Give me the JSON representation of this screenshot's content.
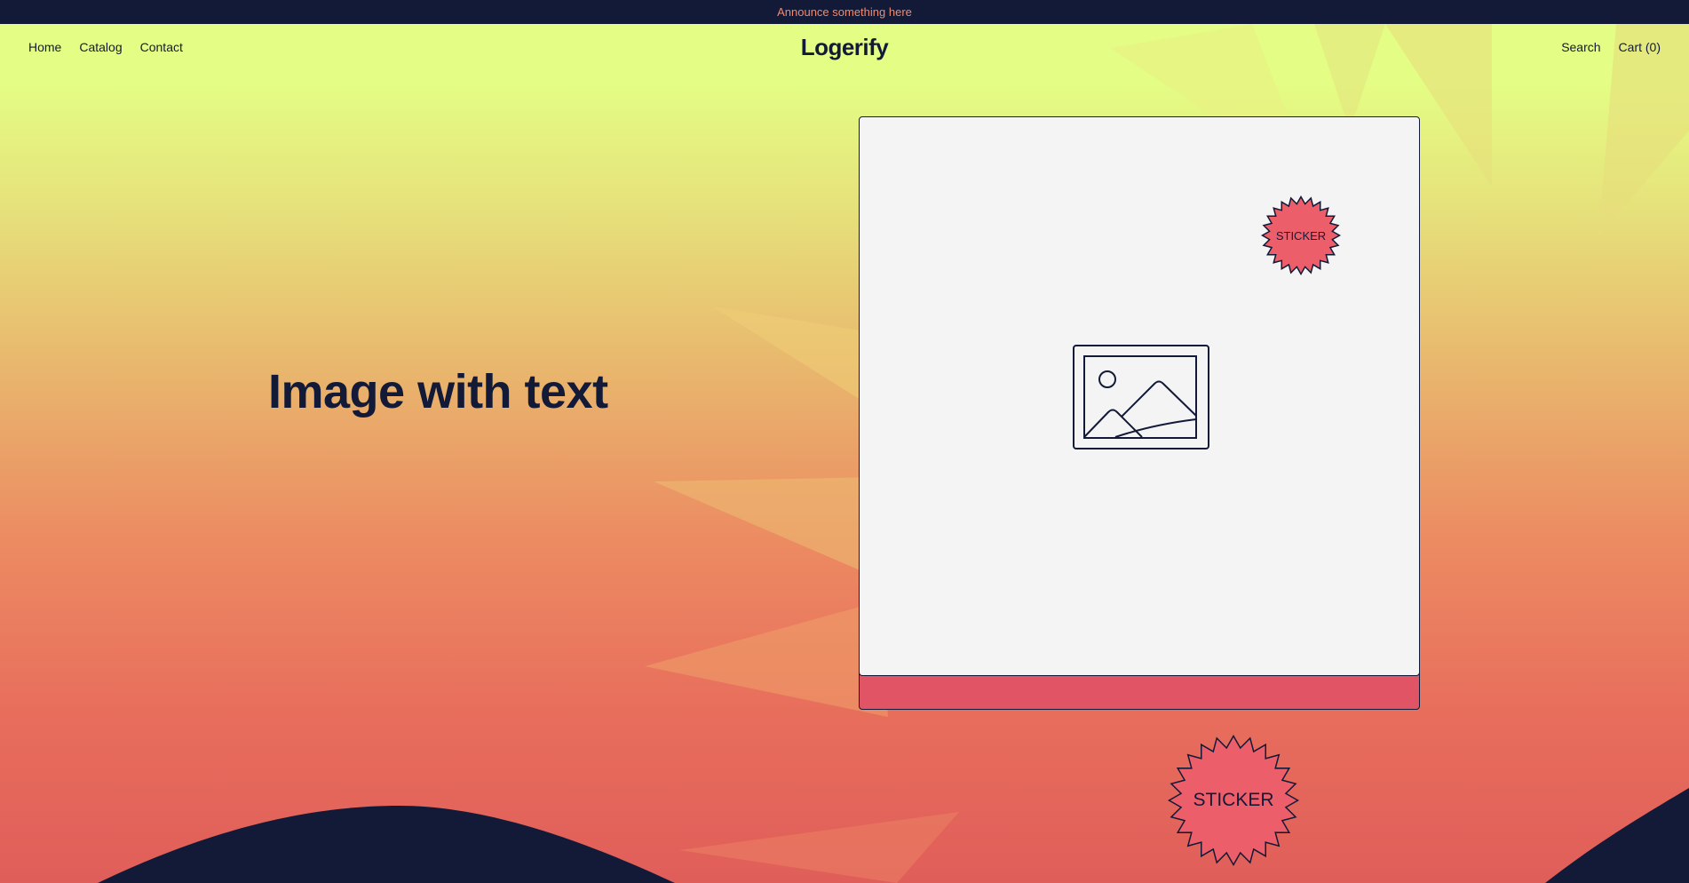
{
  "announcement": {
    "text": "Announce something here"
  },
  "header": {
    "logo": "Logerify",
    "nav_left": [
      {
        "label": "Home"
      },
      {
        "label": "Catalog"
      },
      {
        "label": "Contact"
      }
    ],
    "nav_right": [
      {
        "label": "Search"
      },
      {
        "label": "Cart (0)"
      }
    ]
  },
  "section": {
    "heading": "Image with text",
    "image": {
      "icon": "image-placeholder-icon"
    },
    "stickers": [
      {
        "label": "STICKER"
      },
      {
        "label": "STICKER"
      }
    ]
  },
  "colors": {
    "navy": "#121a37",
    "lime": "#e4fd84",
    "coral": "#e05e5a",
    "sticker": "#ec5f6a",
    "announcement_text": "#f08a6d",
    "card": "#f4f4f4"
  }
}
